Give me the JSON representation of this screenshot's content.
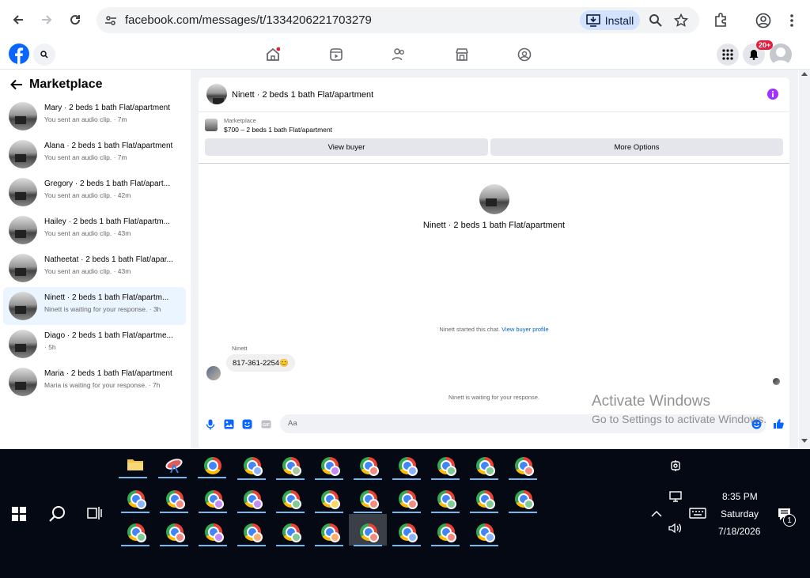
{
  "browser": {
    "url": "facebook.com/messages/t/1334206221703279",
    "install_label": "Install"
  },
  "fb": {
    "notif_badge": "20+"
  },
  "sidebar": {
    "title": "Marketplace",
    "conversations": [
      {
        "title": "Mary · 2 beds 1 bath Flat/apartment",
        "subtitle": "You sent an audio clip. · 7m"
      },
      {
        "title": "Alana · 2 beds 1 bath Flat/apartment",
        "subtitle": "You sent an audio clip. · 7m"
      },
      {
        "title": "Gregory · 2 beds 1 bath Flat/apart...",
        "subtitle": "You sent an audio clip. · 42m"
      },
      {
        "title": "Hailey · 2 beds 1 bath Flat/apartm...",
        "subtitle": "You sent an audio clip. · 43m"
      },
      {
        "title": "Natheetat · 2 beds 1 bath Flat/apar...",
        "subtitle": "You sent an audio clip. · 43m"
      },
      {
        "title": "Ninett · 2 beds 1 bath Flat/apartm...",
        "subtitle": "Ninett is waiting for your response. · 3h"
      },
      {
        "title": "Diago · 2 beds 1 bath Flat/apartme...",
        "subtitle": "· 5h"
      },
      {
        "title": "Maria · 2 beds 1 bath Flat/apartment",
        "subtitle": "Maria is waiting for your response. · 7h"
      }
    ]
  },
  "chat": {
    "title": "Ninett · 2 beds 1 bath Flat/apartment",
    "listing_source": "Marketplace",
    "listing_desc": "$700 – 2 beds 1 bath Flat/apartment",
    "view_buyer": "View buyer",
    "more_options": "More Options",
    "profile_name": "Ninett · 2 beds 1 bath Flat/apartment",
    "started_text": "Ninett started this chat.",
    "view_buyer_profile": "View buyer profile",
    "sender_name": "Ninett",
    "message": "817-361-2254😊",
    "waiting_text": "Ninett is waiting for your response.",
    "composer_placeholder": "Aa"
  },
  "watermark": {
    "line1": "Activate Windows",
    "line2": "Go to Settings to activate Windows."
  },
  "taskbar": {
    "time": "8:35 PM",
    "day": "Saturday",
    "date": "7/18/2026",
    "notif_count": "1",
    "badge_colors": [
      "#8ab4f8",
      "#a8c7a0",
      "#c58af9",
      "#f28b82",
      "#8ab4f8",
      "#81c995",
      "#81c995",
      "#f28b82",
      "#8ab4f8",
      "#f28b82",
      "#c58af9",
      "#c58af9",
      "#81c995",
      "#fdd663",
      "#f28b82",
      "#f28b82",
      "#81c995",
      "#81c995",
      "#81c995",
      "#81c995",
      "#f28b82",
      "#c58af9",
      "#fcad70",
      "#81c995",
      "#fcad70",
      "#f28b82",
      "#8ab4f8",
      "#f28b82",
      "#8ab4f8",
      "#81c995",
      "#f28b82",
      "#f28b82"
    ]
  }
}
